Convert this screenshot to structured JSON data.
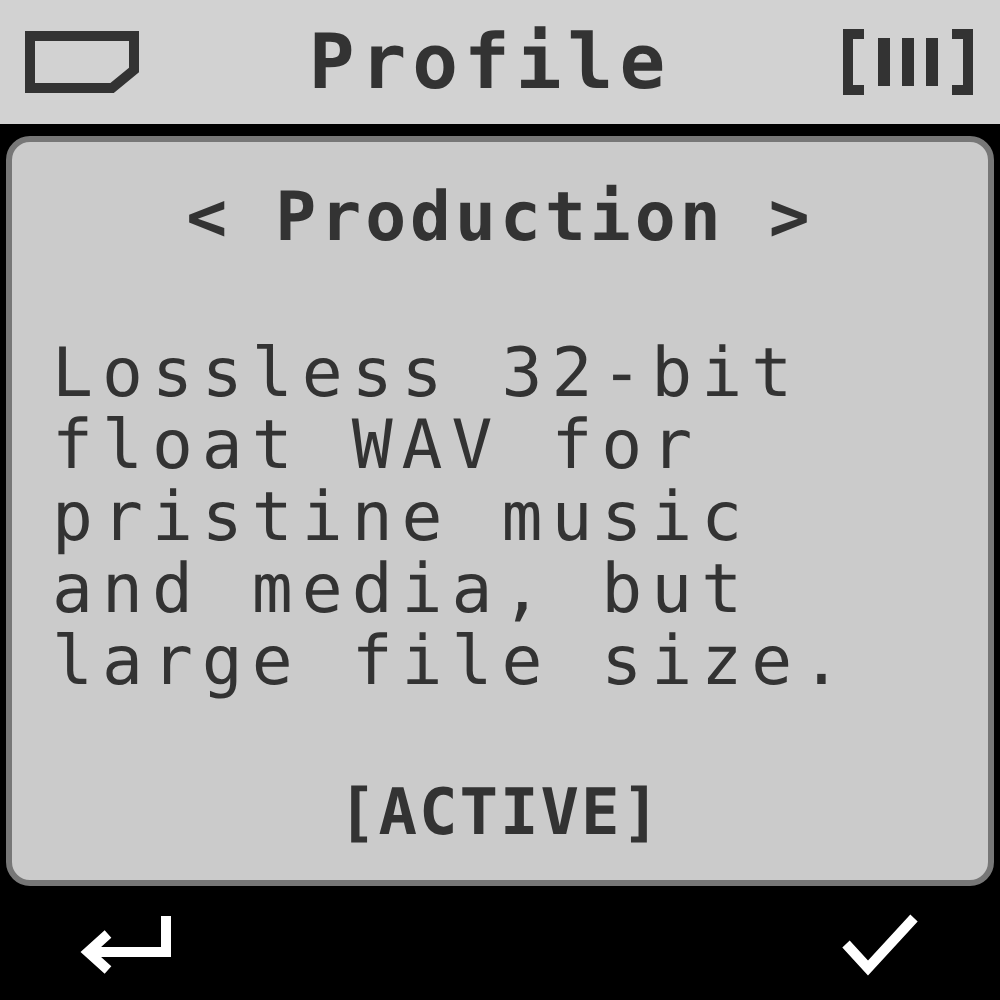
{
  "header": {
    "title": "Profile"
  },
  "selector": {
    "prev": "<",
    "label": "Production",
    "next": ">"
  },
  "description": "Lossless 32-bit float WAV for pristine music and media, but large file size.",
  "status": "[ACTIVE]"
}
